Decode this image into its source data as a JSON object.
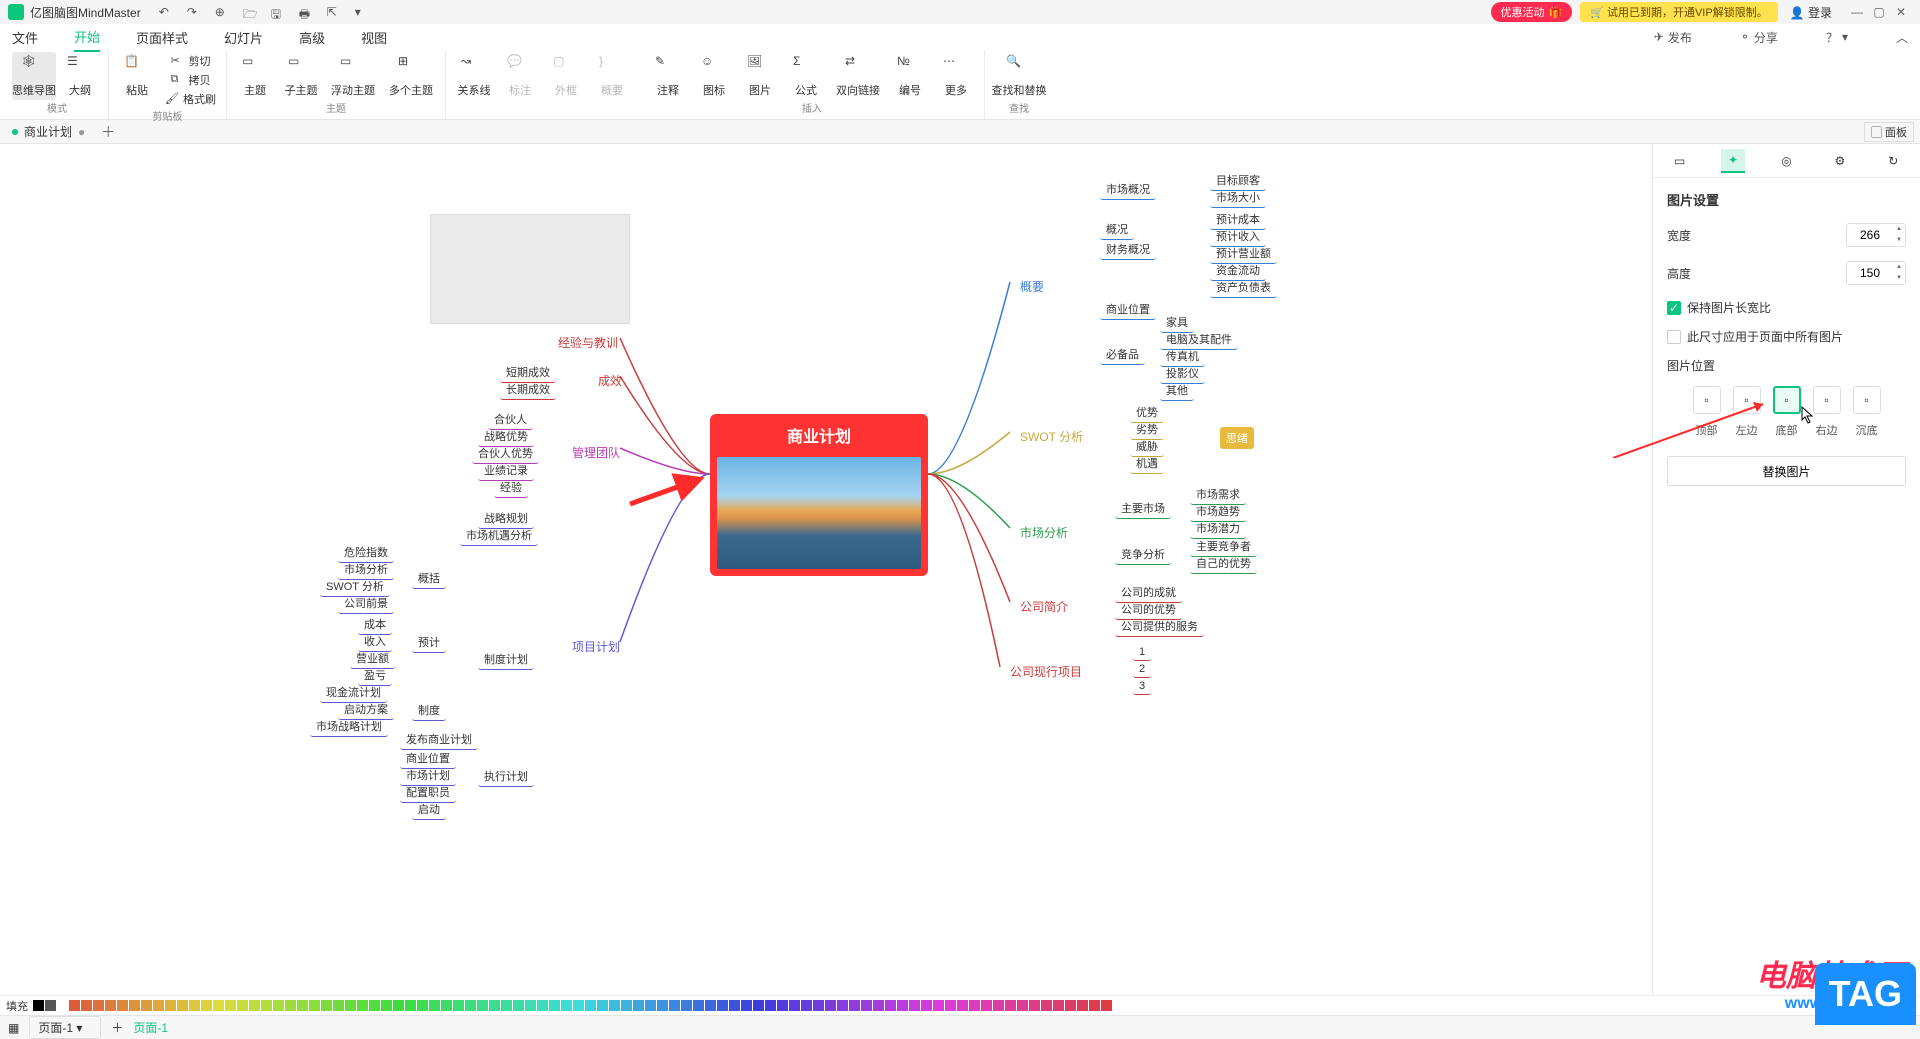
{
  "app": {
    "name": "亿图脑图MindMaster"
  },
  "titlebar": {
    "qat": [
      "undo",
      "redo",
      "new",
      "open",
      "save",
      "print",
      "export"
    ],
    "promo": "优惠活动",
    "vip": "试用已到期，开通VIP解锁限制。",
    "login": "登录",
    "panel_toggle": "面板"
  },
  "menu": {
    "items": [
      "文件",
      "开始",
      "页面样式",
      "幻灯片",
      "高级",
      "视图"
    ],
    "active": 1,
    "publish": "发布",
    "share": "分享"
  },
  "ribbon": {
    "groups": {
      "mode": {
        "label": "模式",
        "btns": [
          {
            "id": "mindmap",
            "label": "思维导图"
          },
          {
            "id": "outline",
            "label": "大纲"
          }
        ]
      },
      "clipboard": {
        "label": "剪贴板",
        "paste": "粘贴",
        "cut": "剪切",
        "copy": "拷贝",
        "format": "格式刷"
      },
      "topic": {
        "label": "主题",
        "btns": [
          {
            "id": "topic",
            "label": "主题"
          },
          {
            "id": "subtopic",
            "label": "子主题"
          },
          {
            "id": "floating",
            "label": "浮动主题"
          },
          {
            "id": "multi",
            "label": "多个主题"
          }
        ]
      },
      "link": {
        "btns": [
          {
            "id": "relation",
            "label": "关系线"
          },
          {
            "id": "callout",
            "label": "标注",
            "disabled": true
          },
          {
            "id": "boundary",
            "label": "外框",
            "disabled": true
          },
          {
            "id": "summary",
            "label": "概要",
            "disabled": true
          }
        ]
      },
      "insert": {
        "label": "插入",
        "btns": [
          {
            "id": "note",
            "label": "注释"
          },
          {
            "id": "icon",
            "label": "图标"
          },
          {
            "id": "image",
            "label": "图片"
          },
          {
            "id": "formula",
            "label": "公式"
          },
          {
            "id": "bilink",
            "label": "双向链接"
          },
          {
            "id": "number",
            "label": "编号"
          },
          {
            "id": "more",
            "label": "更多"
          }
        ]
      },
      "find": {
        "label": "查找",
        "btns": [
          {
            "id": "findreplace",
            "label": "查找和替换"
          }
        ]
      }
    }
  },
  "doc_tabs": {
    "tabs": [
      "商业计划"
    ],
    "modified": true
  },
  "mindmap": {
    "central": "商业计划",
    "small_badge": "思绪",
    "right_branches": [
      {
        "label": "概要",
        "color": "#3a7fd5",
        "children": [
          {
            "label": "市场概况",
            "children": [
              {
                "label": "目标顾客"
              },
              {
                "label": "市场大小"
              }
            ]
          },
          {
            "label": "概况"
          },
          {
            "label": "财务概况",
            "children": [
              {
                "label": "预计成本"
              },
              {
                "label": "预计收入"
              },
              {
                "label": "预计营业额"
              },
              {
                "label": "资金流动"
              },
              {
                "label": "资产负债表"
              }
            ]
          },
          {
            "label": "商业位置"
          },
          {
            "label": "必备品",
            "children": [
              {
                "label": "家具"
              },
              {
                "label": "电脑及其配件"
              },
              {
                "label": "传真机"
              },
              {
                "label": "投影仪"
              },
              {
                "label": "其他"
              }
            ]
          }
        ]
      },
      {
        "label": "SWOT 分析",
        "color": "#c7a83d",
        "children": [
          {
            "label": "优势"
          },
          {
            "label": "劣势"
          },
          {
            "label": "威胁"
          },
          {
            "label": "机遇"
          }
        ]
      },
      {
        "label": "市场分析",
        "color": "#2e9d4f",
        "children": [
          {
            "label": "主要市场",
            "children": [
              {
                "label": "市场需求"
              },
              {
                "label": "市场趋势"
              },
              {
                "label": "市场潜力"
              }
            ]
          },
          {
            "label": "竞争分析",
            "children": [
              {
                "label": "主要竞争者"
              },
              {
                "label": "自己的优势"
              }
            ]
          }
        ]
      },
      {
        "label": "公司简介",
        "color": "#c93b3b",
        "children": [
          {
            "label": "公司的成就"
          },
          {
            "label": "公司的优势"
          },
          {
            "label": "公司提供的服务"
          }
        ]
      },
      {
        "label": "公司现行项目",
        "color": "#c93b3b",
        "children": [
          {
            "label": "1"
          },
          {
            "label": "2"
          },
          {
            "label": "3"
          }
        ]
      }
    ],
    "left_branches": [
      {
        "label": "经验与教训",
        "color": "#c93b3b"
      },
      {
        "label": "成效",
        "color": "#c93b3b",
        "children": [
          {
            "label": "短期成效"
          },
          {
            "label": "长期成效"
          }
        ]
      },
      {
        "label": "管理团队",
        "color": "#b63db6",
        "children": [
          {
            "label": "合伙人"
          },
          {
            "label": "战略优势"
          },
          {
            "label": "合伙人优势"
          },
          {
            "label": "业绩记录"
          },
          {
            "label": "经验"
          }
        ]
      },
      {
        "label": "项目计划",
        "color": "#5a5ad4",
        "children": [
          {
            "label": "战略规划"
          },
          {
            "label": "市场机遇分析"
          },
          {
            "label": "概括",
            "children": [
              {
                "label": "危险指数"
              },
              {
                "label": "市场分析"
              },
              {
                "label": "SWOT 分析"
              },
              {
                "label": "公司前景"
              }
            ]
          },
          {
            "label": "预计",
            "children": [
              {
                "label": "成本"
              },
              {
                "label": "收入"
              },
              {
                "label": "营业额"
              },
              {
                "label": "盈亏"
              }
            ]
          },
          {
            "label": "制度计划"
          },
          {
            "label": "制度",
            "children": [
              {
                "label": "现金流计划"
              },
              {
                "label": "启动方案"
              },
              {
                "label": "市场战略计划"
              }
            ]
          },
          {
            "label": "发布商业计划"
          },
          {
            "label": "执行计划",
            "children": [
              {
                "label": "商业位置"
              },
              {
                "label": "市场计划"
              },
              {
                "label": "配置职员"
              },
              {
                "label": "启动"
              }
            ]
          }
        ]
      }
    ]
  },
  "panel": {
    "title": "图片设置",
    "width_label": "宽度",
    "width_value": "266",
    "height_label": "高度",
    "height_value": "150",
    "keep_ratio": "保持图片长宽比",
    "apply_all": "此尺寸应用于页面中所有图片",
    "position_title": "图片位置",
    "positions": [
      {
        "id": "top",
        "label": "顶部"
      },
      {
        "id": "left",
        "label": "左边"
      },
      {
        "id": "bottom",
        "label": "底部"
      },
      {
        "id": "right",
        "label": "右边"
      },
      {
        "id": "fill",
        "label": "沉底"
      }
    ],
    "active_position": "bottom",
    "replace": "替换图片"
  },
  "color_strip": {
    "label": "填充"
  },
  "status": {
    "page_label": "页面-1",
    "breadcrumb": "页面-1"
  },
  "watermark": {
    "line1": "电脑技术网",
    "line2": "www.tagxp.com",
    "tag": "TAG"
  }
}
